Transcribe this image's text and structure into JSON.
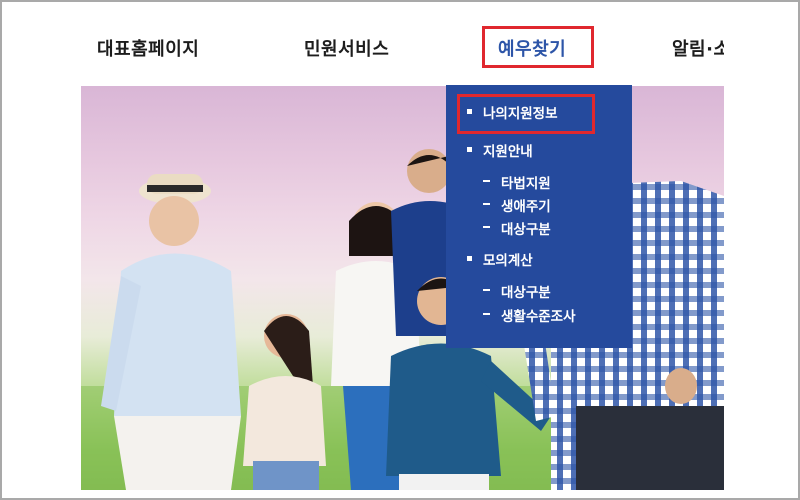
{
  "nav": {
    "items": [
      {
        "label": "대표홈페이지"
      },
      {
        "label": "민원서비스"
      },
      {
        "label": "예우찾기"
      },
      {
        "label": "알림·소"
      }
    ]
  },
  "dropdown": {
    "items": [
      {
        "label": "나의지원정보",
        "level": 1
      },
      {
        "label": "지원안내",
        "level": 1
      },
      {
        "label": "타법지원",
        "level": 2
      },
      {
        "label": "생애주기",
        "level": 2
      },
      {
        "label": "대상구분",
        "level": 2
      },
      {
        "label": "모의계산",
        "level": 1
      },
      {
        "label": "대상구분",
        "level": 2
      },
      {
        "label": "생활수준조사",
        "level": 2
      }
    ]
  },
  "colors": {
    "active_nav": "#2d55a8",
    "dropdown_bg": "#254a9d",
    "highlight": "#e0282e"
  }
}
